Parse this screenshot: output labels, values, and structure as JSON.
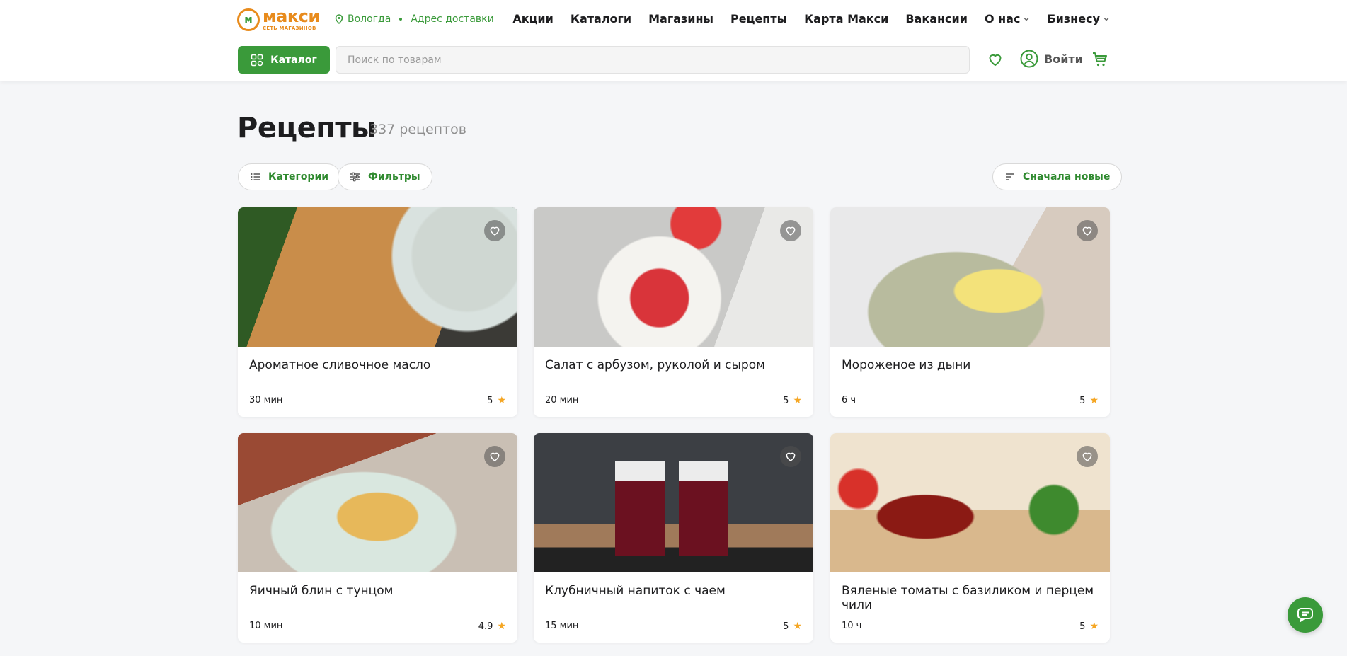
{
  "header": {
    "logo": {
      "name": "макси",
      "subtitle": "СЕТЬ МАГАЗИНОВ"
    },
    "city": "Вологда",
    "address_link": "Адрес доставки",
    "nav": [
      {
        "label": "Акции"
      },
      {
        "label": "Каталоги"
      },
      {
        "label": "Магазины"
      },
      {
        "label": "Рецепты"
      },
      {
        "label": "Карта Макси"
      },
      {
        "label": "Вакансии"
      },
      {
        "label": "О нас",
        "dropdown": true
      },
      {
        "label": "Бизнесу",
        "dropdown": true
      }
    ],
    "catalog_button": "Каталог",
    "search_placeholder": "Поиск по товарам",
    "login_label": "Войти"
  },
  "main": {
    "title": "Рецепты",
    "count": "337 рецептов",
    "filters": {
      "categories": "Категории",
      "filters": "Фильтры",
      "sort": "Сначала новые"
    },
    "recipes": [
      {
        "title": "Ароматное сливочное масло",
        "time": "30 мин",
        "rating": "5"
      },
      {
        "title": "Салат с арбузом, руколой и сыром",
        "time": "20 мин",
        "rating": "5"
      },
      {
        "title": "Мороженое из дыни",
        "time": "6 ч",
        "rating": "5"
      },
      {
        "title": "Яичный блин с тунцом",
        "time": "10 мин",
        "rating": "4.9"
      },
      {
        "title": "Клубничный напиток с чаем",
        "time": "15 мин",
        "rating": "5"
      },
      {
        "title": "Вяленые томаты с базиликом и перцем чили",
        "time": "10 ч",
        "rating": "5"
      }
    ]
  },
  "colors": {
    "brand_green": "#3a9a3a",
    "brand_orange": "#e88b1c",
    "star": "#f5a623"
  }
}
